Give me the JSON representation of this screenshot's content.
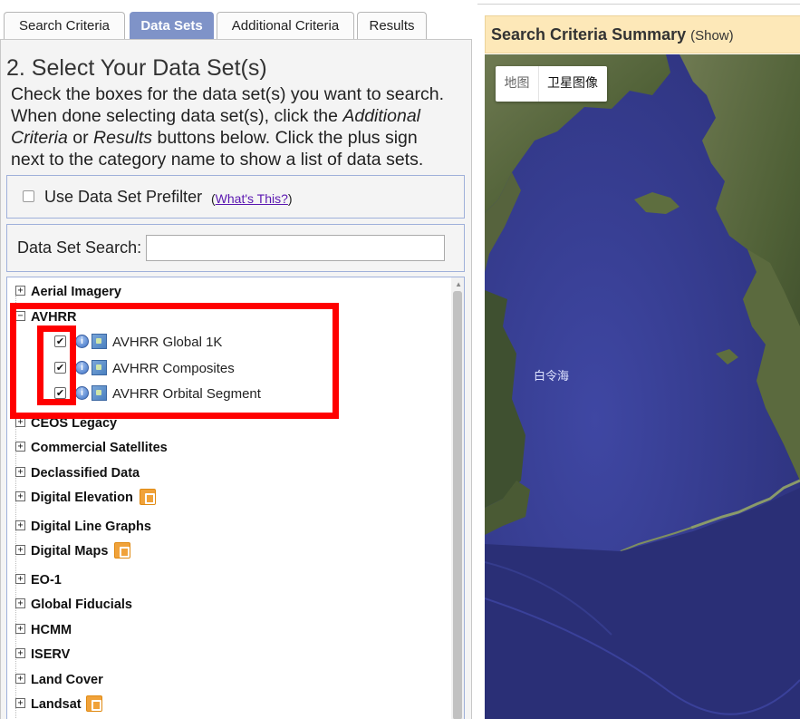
{
  "tabs": [
    {
      "label": "Search Criteria",
      "active": false
    },
    {
      "label": "Data Sets",
      "active": true
    },
    {
      "label": "Additional Criteria",
      "active": false
    },
    {
      "label": "Results",
      "active": false
    }
  ],
  "section": {
    "heading": "2. Select Your Data Set(s)",
    "instructions": {
      "l1": "Check the boxes for the data set(s) you want to search.",
      "l2": "When done selecting data set(s), click the",
      "l2_em": "Additional",
      "l3_em1": "Criteria",
      "l3_mid": "or",
      "l3_em2": "Results",
      "l3_end": "buttons below. Click the plus sign",
      "l4": "next to the category name to show a list of data sets."
    }
  },
  "prefilter": {
    "label": "Use Data Set Prefilter",
    "help_open": "(",
    "help_link": "What's This?",
    "help_close": ")",
    "checked": false
  },
  "dataset_search": {
    "label": "Data Set Search:",
    "value": "",
    "placeholder": ""
  },
  "tree": {
    "categories": [
      {
        "label": "Aerial Imagery",
        "expanded": false
      },
      {
        "label": "AVHRR",
        "expanded": true
      },
      {
        "label": "CEOS Legacy",
        "expanded": false
      },
      {
        "label": "Commercial Satellites",
        "expanded": false
      },
      {
        "label": "Declassified Data",
        "expanded": false
      },
      {
        "label": "Digital Elevation",
        "expanded": false,
        "flag": true
      },
      {
        "label": "Digital Line Graphs",
        "expanded": false
      },
      {
        "label": "Digital Maps",
        "expanded": false,
        "flag": true
      },
      {
        "label": "EO-1",
        "expanded": false
      },
      {
        "label": "Global Fiducials",
        "expanded": false
      },
      {
        "label": "HCMM",
        "expanded": false
      },
      {
        "label": "ISERV",
        "expanded": false
      },
      {
        "label": "Land Cover",
        "expanded": false
      },
      {
        "label": "Landsat",
        "expanded": false,
        "flag": true
      }
    ],
    "avhrr_children": [
      {
        "label": "AVHRR Global 1K",
        "checked": true
      },
      {
        "label": "AVHRR Composites",
        "checked": true
      },
      {
        "label": "AVHRR Orbital Segment",
        "checked": true
      }
    ],
    "expand_glyph": "+",
    "collapse_glyph": "−",
    "check_glyph": "✔",
    "info_glyph": "i"
  },
  "summary": {
    "title": "Search Criteria Summary",
    "show": "(Show)"
  },
  "map": {
    "type_buttons": [
      "地图",
      "卫星图像"
    ],
    "selected_type": "卫星图像",
    "sea_label": "白令海"
  },
  "colors": {
    "active_tab": "#7f93c8",
    "highlight": "#ff0000",
    "summary_bg": "#fde8b8",
    "flag": "#f0a23a"
  }
}
